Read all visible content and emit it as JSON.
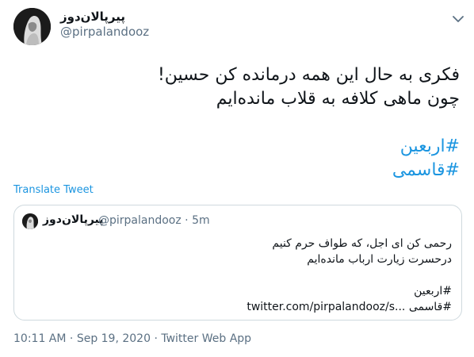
{
  "author": {
    "display_name": "پیرپالان‌دوز",
    "handle": "@pirpalandooz"
  },
  "tweet": {
    "lines": [
      "فکری به حال این همه درمانده کن حسین!",
      "چون ماهی کلافه به قلاب مانده‌ایم"
    ],
    "hashtags": [
      "#اربعین",
      "#قاسمی"
    ]
  },
  "translate_label": "Translate Tweet",
  "quote": {
    "display_name": "پیرپالان‌دوز",
    "handle": "@pirpalandooz",
    "separator": "·",
    "time": "5m",
    "lines": [
      "رحمی کن ای اجل، که طواف حرم کنیم",
      "درحسرت زیارت ارباب مانده‌ایم"
    ],
    "hashtag": "#اربعین",
    "last_hashtag": "#قاسمی",
    "link_text": "twitter.com/pirpalandooz/s..."
  },
  "meta": {
    "time": "10:11 AM",
    "separator": "·",
    "date": "Sep 19, 2020",
    "source": "Twitter Web App"
  },
  "colors": {
    "accent": "#1b95e0",
    "secondary_text": "#5b7083",
    "border": "#cfd9de"
  },
  "icons": [
    "avatar-image",
    "chevron-down-icon"
  ]
}
